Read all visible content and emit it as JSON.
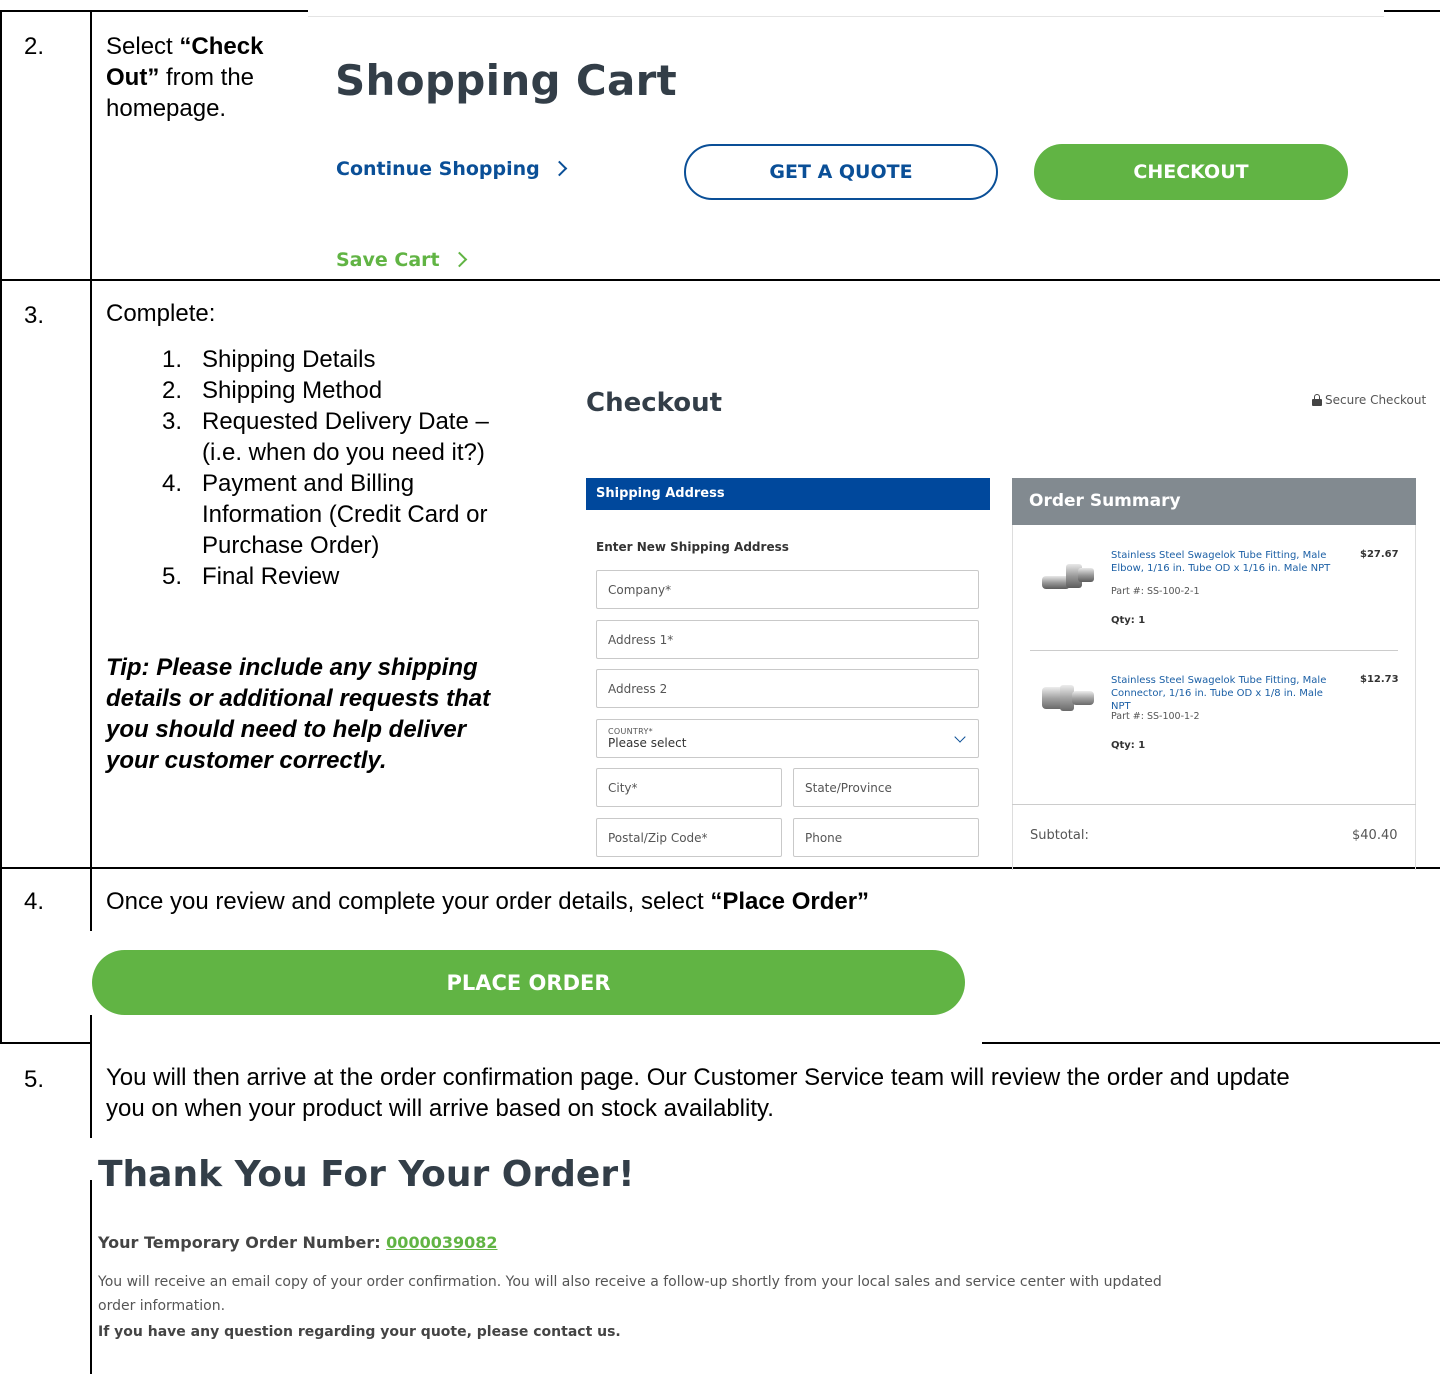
{
  "rows": [
    {
      "number": "2.",
      "instruction": {
        "pre": "Select ",
        "bold1": "“Check",
        "bold2": "Out”",
        "post1": " from the",
        "post2": "homepage."
      },
      "screenshot": {
        "title": "Shopping Cart",
        "continue_shopping": "Continue Shopping",
        "get_quote": "GET A QUOTE",
        "checkout": "CHECKOUT",
        "save_cart": "Save Cart"
      }
    },
    {
      "number": "3.",
      "instruction": {
        "intro": "Complete:",
        "steps": [
          {
            "n": "1.",
            "lines": [
              "Shipping Details"
            ]
          },
          {
            "n": "2.",
            "lines": [
              "Shipping Method"
            ]
          },
          {
            "n": "3.",
            "lines": [
              "Requested Delivery Date –",
              "(i.e. when do you need it?)"
            ]
          },
          {
            "n": "4.",
            "lines": [
              "Payment and Billing",
              "Information (Credit Card or",
              "Purchase Order)"
            ]
          },
          {
            "n": "5.",
            "lines": [
              "Final Review"
            ]
          }
        ],
        "tip": [
          "Tip: Please include any shipping",
          "details or additional requests that",
          "you should need to help deliver",
          "your customer correctly."
        ]
      },
      "screenshot": {
        "title": "Checkout",
        "secure": "Secure Checkout",
        "shipping_header": "Shipping Address",
        "enter_new": "Enter New Shipping Address",
        "fields": {
          "company": "Company*",
          "address1": "Address 1*",
          "address2": "Address 2",
          "country_label": "COUNTRY*",
          "country_value": "Please select",
          "city": "City*",
          "state": "State/Province",
          "postal": "Postal/Zip Code*",
          "phone": "Phone"
        },
        "order_summary": {
          "title": "Order Summary",
          "items": [
            {
              "name_lines": [
                "Stainless Steel Swagelok Tube Fitting, Male",
                "Elbow, 1/16 in. Tube OD x 1/16 in. Male NPT"
              ],
              "price": "$27.67",
              "part": "Part #: SS-100-2-1",
              "qty": "Qty: 1"
            },
            {
              "name_lines": [
                "Stainless Steel Swagelok Tube Fitting, Male",
                "Connector, 1/16 in. Tube OD x 1/8 in. Male NPT"
              ],
              "price": "$12.73",
              "part": "Part #: SS-100-1-2",
              "qty": "Qty: 1"
            }
          ],
          "subtotal_label": "Subtotal:",
          "subtotal_value": "$40.40"
        }
      }
    },
    {
      "number": "4.",
      "instruction": {
        "pre": "Once you review and complete your order details, select ",
        "bold": "“Place Order”"
      },
      "screenshot": {
        "place_order": "PLACE ORDER"
      }
    },
    {
      "number": "5.",
      "instruction": {
        "line1": "You will then arrive at the order confirmation page. Our Customer Service team will review the order and update",
        "line2": "you on when your product will arrive based on stock availablity."
      },
      "screenshot": {
        "title": "Thank You For Your Order!",
        "temp_label": "Your Temporary Order Number: ",
        "temp_number": "0000039082",
        "info_line1": "You will receive an email copy of your order confirmation. You will also receive a follow-up shortly from your local sales and service center with updated",
        "info_line2": "order information.",
        "contact": "If you have any question regarding your quote, please contact us."
      }
    }
  ],
  "colors": {
    "green": "#61b444",
    "blue": "#0a4f97",
    "nav_blue": "#00489c",
    "summary_gray": "#828a90",
    "heading": "#333e48"
  }
}
